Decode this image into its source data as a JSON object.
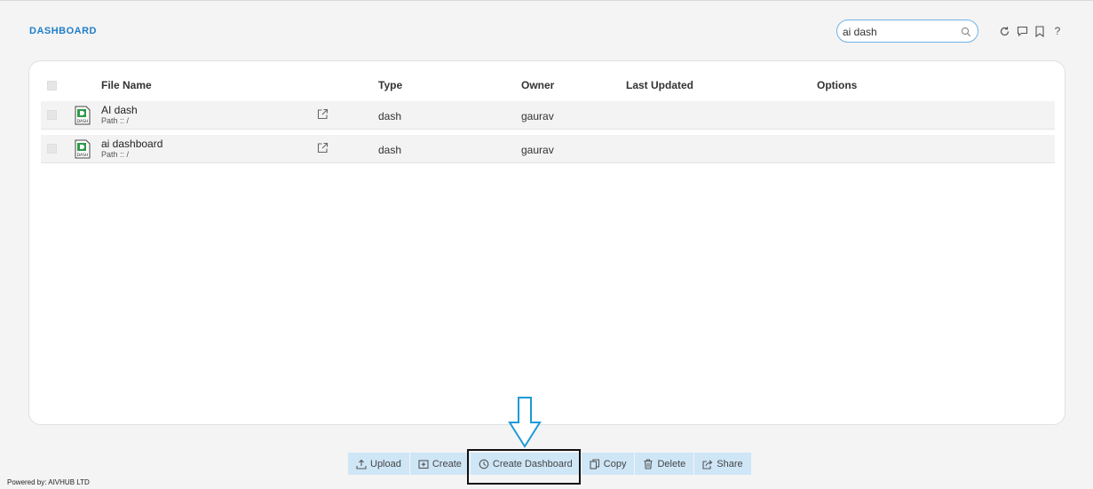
{
  "header": {
    "title": "DASHBOARD",
    "search_value": "ai dash",
    "search_placeholder": "Search"
  },
  "table": {
    "columns": [
      "File Name",
      "Type",
      "Owner",
      "Last Updated",
      "Options"
    ],
    "rows": [
      {
        "name": "AI dash",
        "path": "Path :: /",
        "type": "dash",
        "owner": "gaurav",
        "updated": "",
        "icon_label": "DASH"
      },
      {
        "name": "ai dashboard",
        "path": "Path :: /",
        "type": "dash",
        "owner": "gaurav",
        "updated": "",
        "icon_label": "DASH"
      }
    ]
  },
  "toolbar": {
    "upload": "Upload",
    "create": "Create",
    "create_dashboard": "Create Dashboard",
    "copy": "Copy",
    "delete": "Delete",
    "share": "Share"
  },
  "top_icons": {
    "help": "?"
  },
  "footer": {
    "text": "Powered by: AIVHUB LTD"
  },
  "colors": {
    "accent": "#1e7ec8",
    "toolbar_bg": "#cfe6f7",
    "annotation_arrow": "#1e9ad6"
  }
}
